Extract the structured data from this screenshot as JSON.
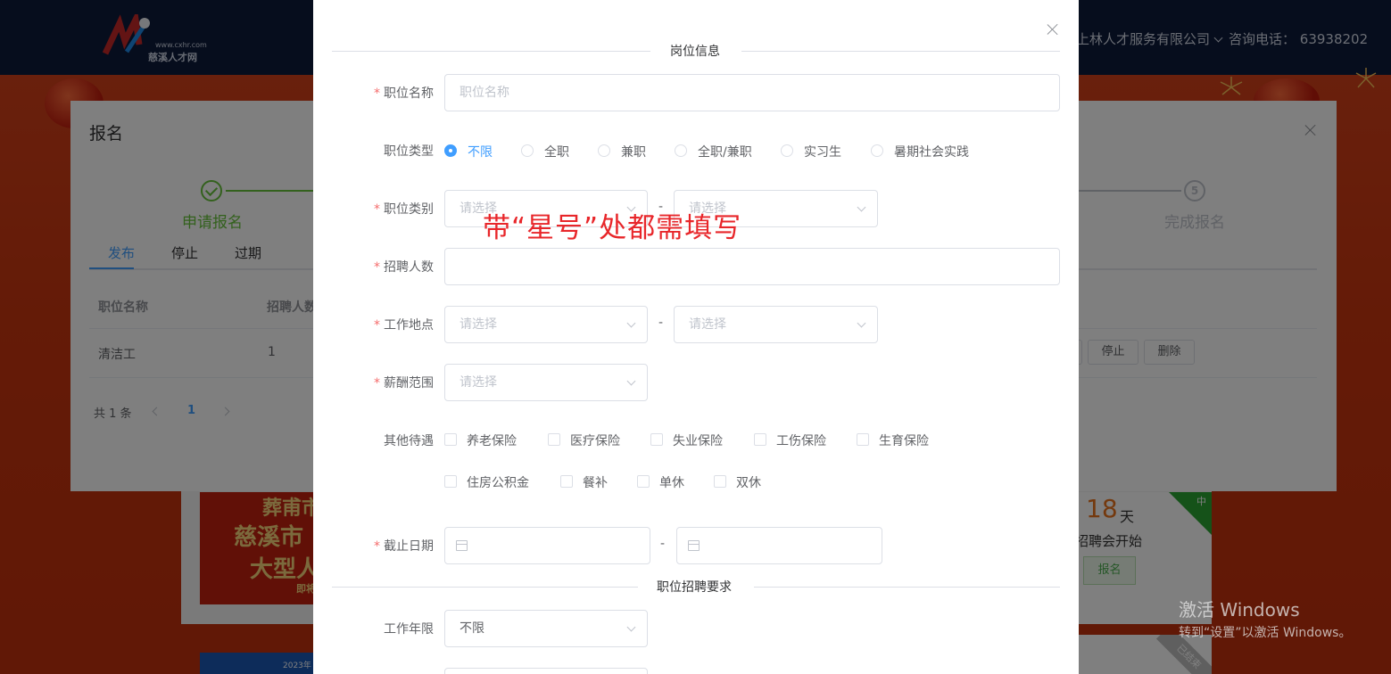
{
  "header": {
    "logo_url": "www.cxhr.com",
    "logo_name": "慈溪人才网",
    "company": "上林人才服务有限公司",
    "hotline": "咨询电话： 63938202"
  },
  "background": {
    "promo_lines": [
      "葬甫市",
      "慈溪市",
      "大型人",
      "即将"
    ],
    "countdown_days": "18",
    "countdown_unit": "天",
    "countdown_desc": "招聘会开始",
    "register_button": "报名",
    "ribbon": "中",
    "promo2_text": "2023年",
    "ended_tag": "已结束"
  },
  "signup_dialog": {
    "title": "报名",
    "steps": {
      "first": "申请报名",
      "last": "完成报名",
      "last_number": "5"
    },
    "tabs": [
      "发布",
      "停止",
      "过期"
    ],
    "columns": [
      "职位名称",
      "招聘人数"
    ],
    "rows": [
      {
        "name": "清洁工",
        "count": "1",
        "actions": [
          "停止",
          "删除"
        ]
      }
    ],
    "pager": {
      "total": "共 1 条",
      "page": "1"
    }
  },
  "job_dialog": {
    "section_info": "岗位信息",
    "section_req": "职位招聘要求",
    "labels": {
      "name": "职位名称",
      "type": "职位类型",
      "category": "职位类别",
      "count": "招聘人数",
      "location": "工作地点",
      "salary": "薪酬范围",
      "benefits": "其他待遇",
      "deadline": "截止日期",
      "years": "工作年限"
    },
    "placeholders": {
      "name": "职位名称",
      "select": "请选择"
    },
    "job_types": [
      "不限",
      "全职",
      "兼职",
      "全职/兼职",
      "实习生",
      "暑期社会实践"
    ],
    "job_type_selected": "不限",
    "benefits_row1": [
      "养老保险",
      "医疗保险",
      "失业保险",
      "工伤保险",
      "生育保险"
    ],
    "benefits_row2": [
      "住房公积金",
      "餐补",
      "单休",
      "双休"
    ],
    "years_value": "不限",
    "separator": "-"
  },
  "annotation": "带“星号”处都需填写",
  "watermark": {
    "line1": "激活 Windows",
    "line2": "转到“设置”以激活 Windows。"
  },
  "colors": {
    "primary": "#409eff",
    "required": "#f56c6c",
    "success": "#67c23a",
    "annotation": "#e8262a"
  }
}
